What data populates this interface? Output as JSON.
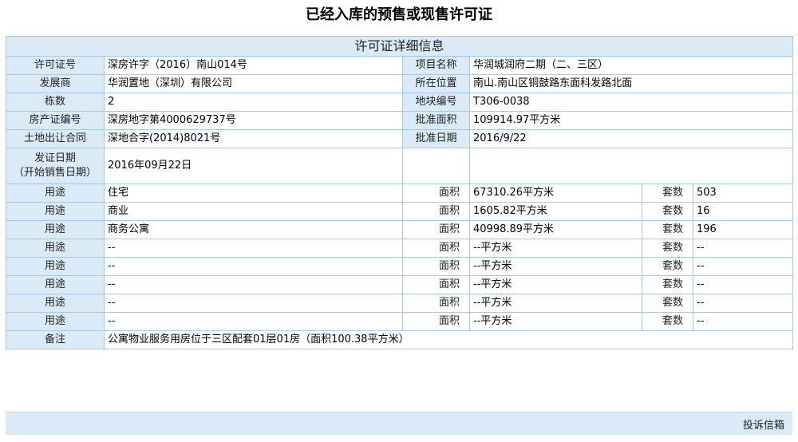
{
  "page_title": "已经入库的预售或现售许可证",
  "section_title": "许可证详细信息",
  "info": [
    {
      "l1": "许可证号",
      "v1": "深房许字（2016）南山014号",
      "l2": "项目名称",
      "v2": "华润城润府二期（二、三区）"
    },
    {
      "l1": "发展商",
      "v1": "华润置地（深圳）有限公司",
      "l2": "所在位置",
      "v2": "南山.南山区铜鼓路东面科发路北面"
    },
    {
      "l1": "栋数",
      "v1": "2",
      "l2": "地块编号",
      "v2": "T306-0038"
    },
    {
      "l1": "房产证编号",
      "v1": "深房地字第4000629737号",
      "l2": "批准面积",
      "v2": "109914.97平方米"
    },
    {
      "l1": "土地出让合同",
      "v1": "深地合字(2014)8021号",
      "l2": "批准日期",
      "v2": "2016/9/22"
    }
  ],
  "issue_date": {
    "label_line1": "发证日期",
    "label_line2": "（开始销售日期）",
    "value": "2016年09月22日"
  },
  "usage_rows": [
    {
      "use_label": "用途",
      "use": "住宅",
      "area_label": "面积",
      "area": "67310.26平方米",
      "units_label": "套数",
      "units": "503"
    },
    {
      "use_label": "用途",
      "use": "商业",
      "area_label": "面积",
      "area": "1605.82平方米",
      "units_label": "套数",
      "units": "16"
    },
    {
      "use_label": "用途",
      "use": "商务公寓",
      "area_label": "面积",
      "area": "40998.89平方米",
      "units_label": "套数",
      "units": "196"
    },
    {
      "use_label": "用途",
      "use": "--",
      "area_label": "面积",
      "area": "--平方米",
      "units_label": "套数",
      "units": "--"
    },
    {
      "use_label": "用途",
      "use": "--",
      "area_label": "面积",
      "area": "--平方米",
      "units_label": "套数",
      "units": "--"
    },
    {
      "use_label": "用途",
      "use": "--",
      "area_label": "面积",
      "area": "--平方米",
      "units_label": "套数",
      "units": "--"
    },
    {
      "use_label": "用途",
      "use": "--",
      "area_label": "面积",
      "area": "--平方米",
      "units_label": "套数",
      "units": "--"
    },
    {
      "use_label": "用途",
      "use": "--",
      "area_label": "面积",
      "area": "--平方米",
      "units_label": "套数",
      "units": "--"
    }
  ],
  "remark": {
    "label": "备注",
    "value": "公寓物业服务用房位于三区配套01层01房（面积100.38平方米）"
  },
  "footer": {
    "complaint_label": "投诉信箱"
  },
  "colors": {
    "label_bg": "#dbeaf7",
    "border": "#a4c8e6"
  }
}
